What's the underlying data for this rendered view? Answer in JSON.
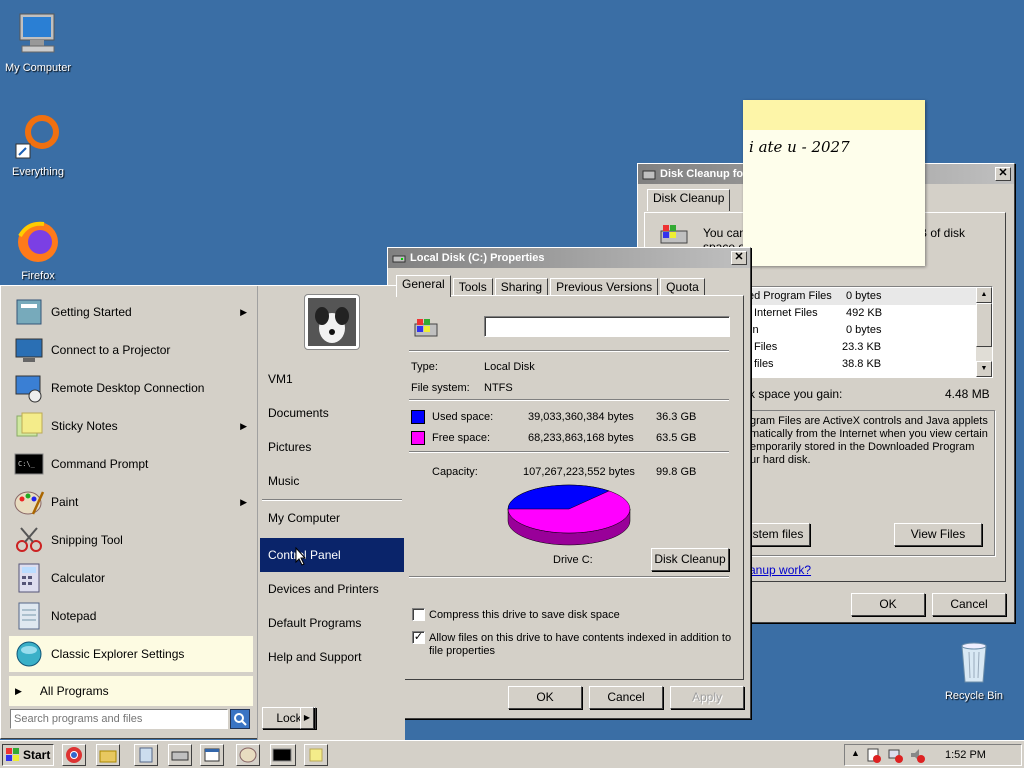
{
  "desktop": {
    "icons": [
      {
        "label": "My Computer"
      },
      {
        "label": "Everything"
      },
      {
        "label": "Firefox"
      },
      {
        "label": "Recycle Bin"
      }
    ]
  },
  "sticky_note": {
    "text": "i ate u - 2027"
  },
  "disk_cleanup": {
    "title": "Disk Cleanup fo",
    "tab": "Disk Cleanup",
    "intro": "You can",
    "intro2": "B of disk",
    "intro3": "space o",
    "files": [
      {
        "name": "ed Program Files",
        "size": "0 bytes"
      },
      {
        "name": "Internet Files",
        "size": "492 KB"
      },
      {
        "name": "in",
        "size": "0 bytes"
      },
      {
        "name": "Files",
        "size": "23.3 KB"
      },
      {
        "name": "files",
        "size": "38.8 KB"
      }
    ],
    "gain_label": "k space you gain:",
    "gain_value": "4.48 MB",
    "description_lines": [
      "gram Files are ActiveX controls and Java applets",
      "matically from the Internet when you view certain",
      "emporarily stored in the Downloaded Program",
      "ur hard disk."
    ],
    "system_files_btn": "stem files",
    "view_files_btn": "View Files",
    "link": "anup work?",
    "ok": "OK",
    "cancel": "Cancel"
  },
  "properties": {
    "title": "Local Disk (C:) Properties",
    "tabs": [
      "General",
      "Tools",
      "Sharing",
      "Previous Versions",
      "Quota"
    ],
    "label_value": "",
    "type_label": "Type:",
    "type_value": "Local Disk",
    "fs_label": "File system:",
    "fs_value": "NTFS",
    "used_label": "Used space:",
    "used_bytes": "39,033,360,384 bytes",
    "used_gb": "36.3 GB",
    "free_label": "Free space:",
    "free_bytes": "68,233,863,168 bytes",
    "free_gb": "63.5 GB",
    "capacity_label": "Capacity:",
    "capacity_bytes": "107,267,223,552 bytes",
    "capacity_gb": "99.8 GB",
    "drive_label": "Drive C:",
    "cleanup_btn": "Disk Cleanup",
    "compress_label": "Compress this drive to save disk space",
    "index_label_1": "Allow files on this drive to have contents indexed in addition to",
    "index_label_2": "file properties",
    "ok": "OK",
    "cancel": "Cancel",
    "apply": "Apply",
    "used_fraction": 0.364,
    "colors": {
      "used": "#0000ff",
      "free": "#ff00ff"
    }
  },
  "start_menu": {
    "left_items": [
      {
        "label": "Getting Started",
        "icon": "getting-started-icon",
        "arrow": "▶"
      },
      {
        "label": "Connect to a Projector",
        "icon": "projector-icon",
        "arrow": ""
      },
      {
        "label": "Remote Desktop Connection",
        "icon": "remote-desktop-icon",
        "arrow": ""
      },
      {
        "label": "Sticky Notes",
        "icon": "sticky-notes-icon",
        "arrow": "▶"
      },
      {
        "label": "Command Prompt",
        "icon": "command-prompt-icon",
        "arrow": ""
      },
      {
        "label": "Paint",
        "icon": "paint-icon",
        "arrow": "▶"
      },
      {
        "label": "Snipping Tool",
        "icon": "snipping-tool-icon",
        "arrow": ""
      },
      {
        "label": "Calculator",
        "icon": "calculator-icon",
        "arrow": ""
      },
      {
        "label": "Notepad",
        "icon": "notepad-icon",
        "arrow": ""
      },
      {
        "label": "Classic Explorer Settings",
        "icon": "classic-explorer-icon",
        "arrow": ""
      }
    ],
    "all_programs": "All Programs",
    "search_placeholder": "Search programs and files",
    "right_items": [
      "VM1",
      "Documents",
      "Pictures",
      "Music",
      "My Computer",
      "Control Panel",
      "Devices and Printers",
      "Default Programs",
      "Help and Support"
    ],
    "lock_label": "Lock"
  },
  "taskbar": {
    "start_label": "Start",
    "clock": "1:52 PM"
  }
}
